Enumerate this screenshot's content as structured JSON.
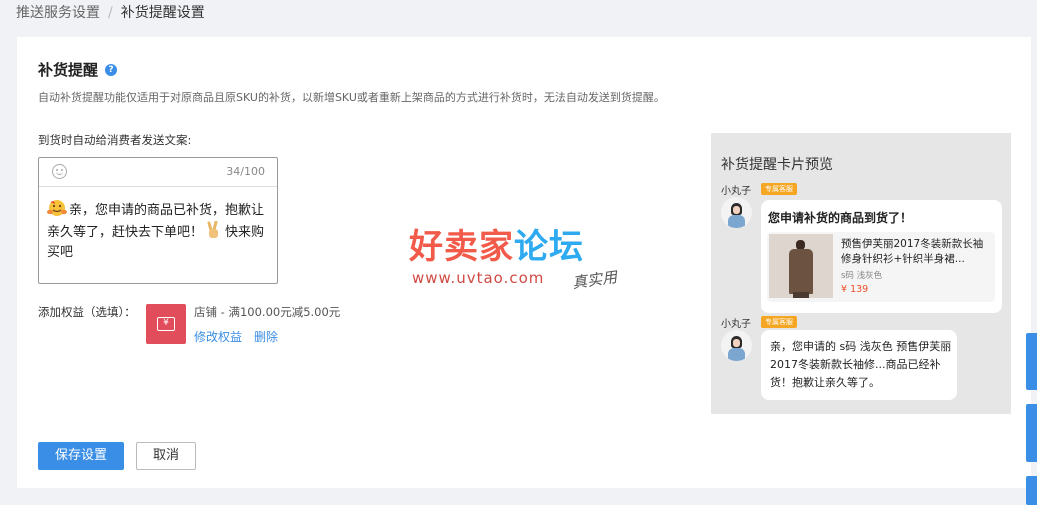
{
  "breadcrumb": {
    "parent": "推送服务设置",
    "separator": "/",
    "current": "补货提醒设置"
  },
  "section": {
    "title": "补货提醒",
    "help_icon": "question-circle-icon",
    "description": "自动补货提醒功能仅适用于对原商品且原SKU的补货，以新增SKU或者重新上架商品的方式进行补货时，无法自动发送到货提醒。"
  },
  "message_field": {
    "label": "到货时自动给消费者发送文案:",
    "emoji_icon": "smile-icon",
    "counter": "34/100",
    "text_part1": "亲，您申请的商品已补货，抱歉让亲久等了，赶快去下单吧！",
    "text_part2": "快来购买吧"
  },
  "benefit": {
    "label": "添加权益（选填）：",
    "coupon_icon": "coupon-icon",
    "coupon_symbol": "¥",
    "coupon_text": "店铺 - 满100.00元减5.00元",
    "edit_link": "修改权益",
    "delete_link": "删除"
  },
  "actions": {
    "save": "保存设置",
    "cancel": "取消"
  },
  "watermark": {
    "main_part1": "好卖家",
    "main_part2": "论坛",
    "url": "www.uvtao.com",
    "handwritten": "真实用"
  },
  "preview": {
    "title": "补货提醒卡片预览",
    "sender": "小丸子",
    "vip_tag": "专属客服",
    "card_title": "您申请补货的商品到货了！",
    "product_name": "预售伊芙丽2017冬装新款长袖修身针织衫+针织半身裙...",
    "product_spec": "s码 浅灰色",
    "product_price": "¥ 139",
    "message2": "亲，您申请的 s码 浅灰色 预售伊芙丽2017冬装新款长袖修...商品已经补货！抱歉让亲久等了。"
  },
  "colors": {
    "primary": "#3a8ee6",
    "coupon": "#e14d5a",
    "price": "#f04f2a",
    "tag": "#f5a623"
  }
}
